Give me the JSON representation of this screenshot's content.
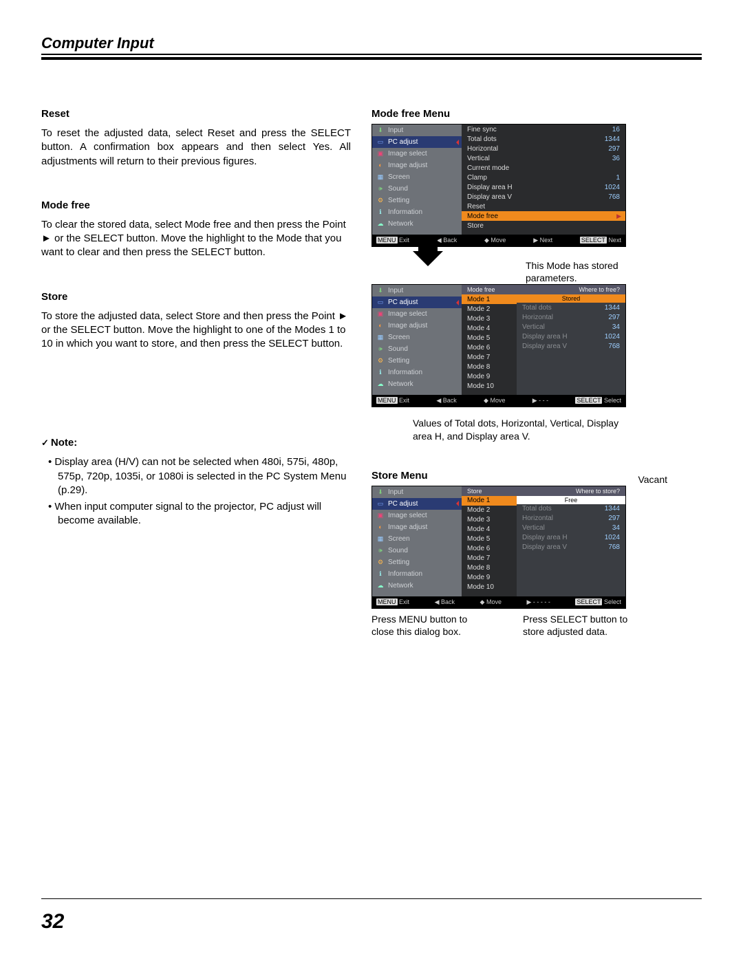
{
  "header": "Computer Input",
  "page_number": "32",
  "left": {
    "reset": {
      "h": "Reset",
      "p": "To reset the adjusted data, select Reset and press the SELECT button. A confirmation box appears and then select Yes. All adjustments will return to their previous figures."
    },
    "modefree": {
      "h": "Mode free",
      "p": "To clear the stored data, select Mode free and then press the Point ► or the SELECT button. Move the highlight to the Mode that you want to clear and then press the SELECT button."
    },
    "store": {
      "h": "Store",
      "p": "To store the adjusted data, select Store and then press the Point ► or the SELECT button. Move the highlight to one of the Modes 1 to 10 in which you want to store, and then press the SELECT button."
    },
    "note": {
      "h": "Note:",
      "b1": "Display area (H/V) can not be selected when 480i, 575i, 480p, 575p, 720p, 1035i, or 1080i is selected in the PC System Menu (p.29).",
      "b2": "When input computer signal to the projector, PC adjust will become available."
    }
  },
  "nav_items": [
    "Input",
    "PC adjust",
    "Image select",
    "Image adjust",
    "Screen",
    "Sound",
    "Setting",
    "Information",
    "Network"
  ],
  "osd1": {
    "title": "Mode free Menu",
    "rows": [
      {
        "k": "Fine sync",
        "v": "16"
      },
      {
        "k": "Total dots",
        "v": "1344"
      },
      {
        "k": "Horizontal",
        "v": "297"
      },
      {
        "k": "Vertical",
        "v": "36"
      },
      {
        "k": "Current mode",
        "v": ""
      },
      {
        "k": "Clamp",
        "v": "1"
      },
      {
        "k": "Display area H",
        "v": "1024"
      },
      {
        "k": "Display area V",
        "v": "768"
      },
      {
        "k": "Reset",
        "v": ""
      }
    ],
    "hi": "Mode free",
    "after": "Store",
    "foot": {
      "exit": "Exit",
      "back": "Back",
      "move": "Move",
      "next1": "Next",
      "next2": "Next"
    }
  },
  "callout1": "This Mode has stored parameters.",
  "osd2": {
    "hdr_left": "Mode free",
    "hdr_right": "Where to free?",
    "hi": "Mode 1",
    "modes": [
      "Mode 2",
      "Mode 3",
      "Mode 4",
      "Mode 5",
      "Mode 6",
      "Mode 7",
      "Mode 8",
      "Mode 9",
      "Mode 10"
    ],
    "status": "Stored",
    "params": [
      {
        "k": "Total dots",
        "v": "1344"
      },
      {
        "k": "Horizontal",
        "v": "297"
      },
      {
        "k": "Vertical",
        "v": "34"
      },
      {
        "k": "Display area H",
        "v": "1024"
      },
      {
        "k": "Display area V",
        "v": "768"
      }
    ],
    "foot": {
      "exit": "Exit",
      "back": "Back",
      "move": "Move",
      "dash": "- - -",
      "sel": "Select"
    }
  },
  "callout2": "Values of Total dots, Horizontal, Vertical, Display area H, and Display area V.",
  "osd3": {
    "title": "Store Menu",
    "vacant": "Vacant",
    "hdr_left": "Store",
    "hdr_right": "Where to store?",
    "hi": "Mode 1",
    "modes": [
      "Mode 2",
      "Mode 3",
      "Mode 4",
      "Mode 5",
      "Mode 6",
      "Mode 7",
      "Mode 8",
      "Mode 9",
      "Mode 10"
    ],
    "status": "Free",
    "params": [
      {
        "k": "Total dots",
        "v": "1344"
      },
      {
        "k": "Horizontal",
        "v": "297"
      },
      {
        "k": "Vertical",
        "v": "34"
      },
      {
        "k": "Display area H",
        "v": "1024"
      },
      {
        "k": "Display area V",
        "v": "768"
      }
    ],
    "foot": {
      "exit": "Exit",
      "back": "Back",
      "move": "Move",
      "dash": "- - - - -",
      "sel": "Select"
    }
  },
  "callout3a": "Press MENU button to close this dialog box.",
  "callout3b": "Press SELECT button to store adjusted data."
}
